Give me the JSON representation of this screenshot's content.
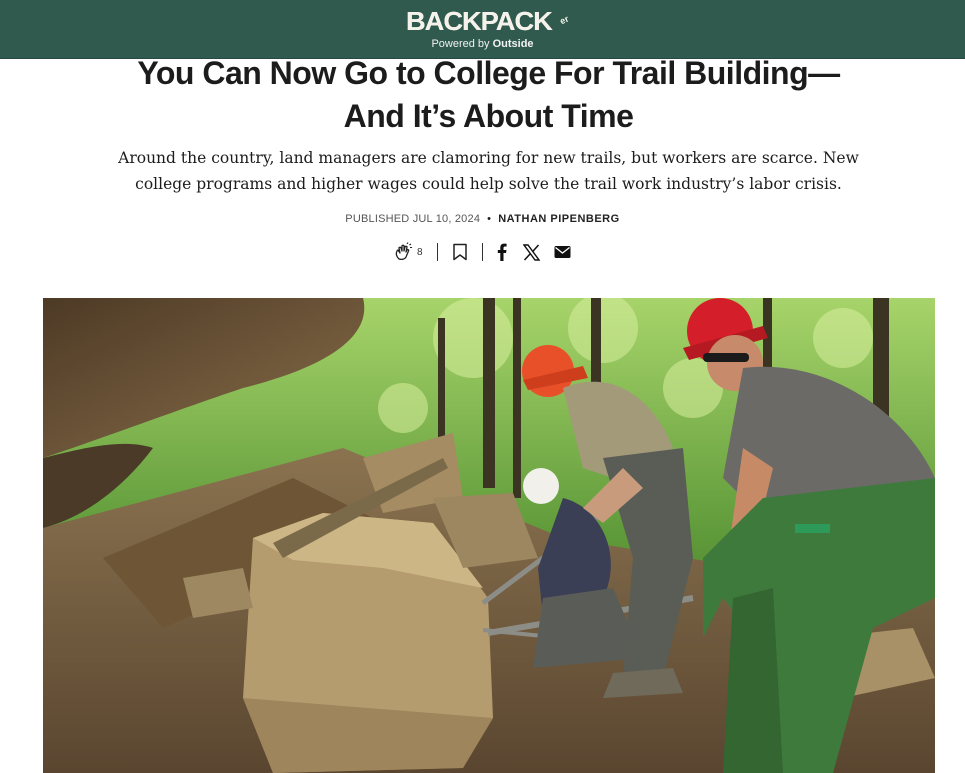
{
  "header": {
    "logo_text": "BACKPACKER",
    "logo_sub": "er",
    "powered_prefix": "Powered by ",
    "powered_brand": "Outside",
    "bg_color": "#2f5a4d"
  },
  "article": {
    "headline_line1": "You Can Now Go to College For Trail Building—",
    "headline_line2": "And It’s About Time",
    "dek": "Around the country, land managers are clamoring for new trails, but workers are scarce. New college programs and higher wages could help solve the trail work industry’s labor crisis.",
    "published": "PUBLISHED JUL 10, 2024",
    "separator": "•",
    "author": "NATHAN PIPENBERG"
  },
  "share": {
    "clap_count": "8",
    "icons": [
      "clap-icon",
      "bookmark-icon",
      "facebook-icon",
      "x-icon",
      "email-icon"
    ]
  },
  "hero": {
    "description_icon": "trail-crew-photo"
  }
}
